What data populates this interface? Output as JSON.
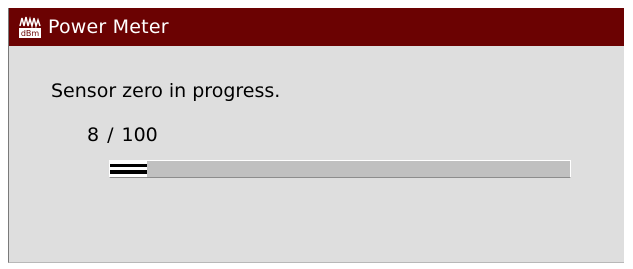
{
  "window": {
    "title": "Power Meter",
    "icon": "power-meter-dbm-icon",
    "titlebar_color": "#6b0202",
    "background_color": "#dedede"
  },
  "dialog": {
    "message": "Sensor zero in progress.",
    "progress": {
      "current": "8",
      "separator": "/",
      "total": "100",
      "fraction": 0.08
    }
  }
}
